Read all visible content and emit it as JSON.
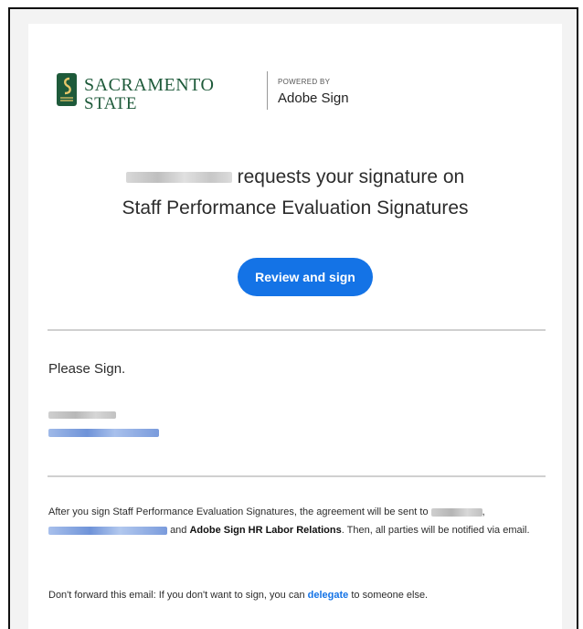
{
  "header": {
    "brand_line1": "SACRAMENTO",
    "brand_line2": "STATE",
    "powered_by": "POWERED BY",
    "product": "Adobe Sign"
  },
  "message": {
    "headline_suffix": "requests your signature on",
    "document_title": "Staff Performance Evaluation Signatures",
    "cta_label": "Review and sign",
    "note": "Please Sign."
  },
  "footer": {
    "after_part1": "After you sign Staff Performance Evaluation Signatures, the agreement will be sent to",
    "after_part2": "and",
    "after_bold": "Adobe Sign HR Labor Relations",
    "after_part3": ". Then, all parties will be notified via email.",
    "dont_forward_prefix": "Don't forward this email: If you don't want to sign, you can",
    "delegate_link": "delegate",
    "dont_forward_suffix": "to someone else."
  },
  "colors": {
    "accent": "#1473e6",
    "brand_green": "#1e5a3a",
    "frame_bg": "#f3f3f3"
  },
  "icons": [
    "sac-state-seal-icon"
  ]
}
